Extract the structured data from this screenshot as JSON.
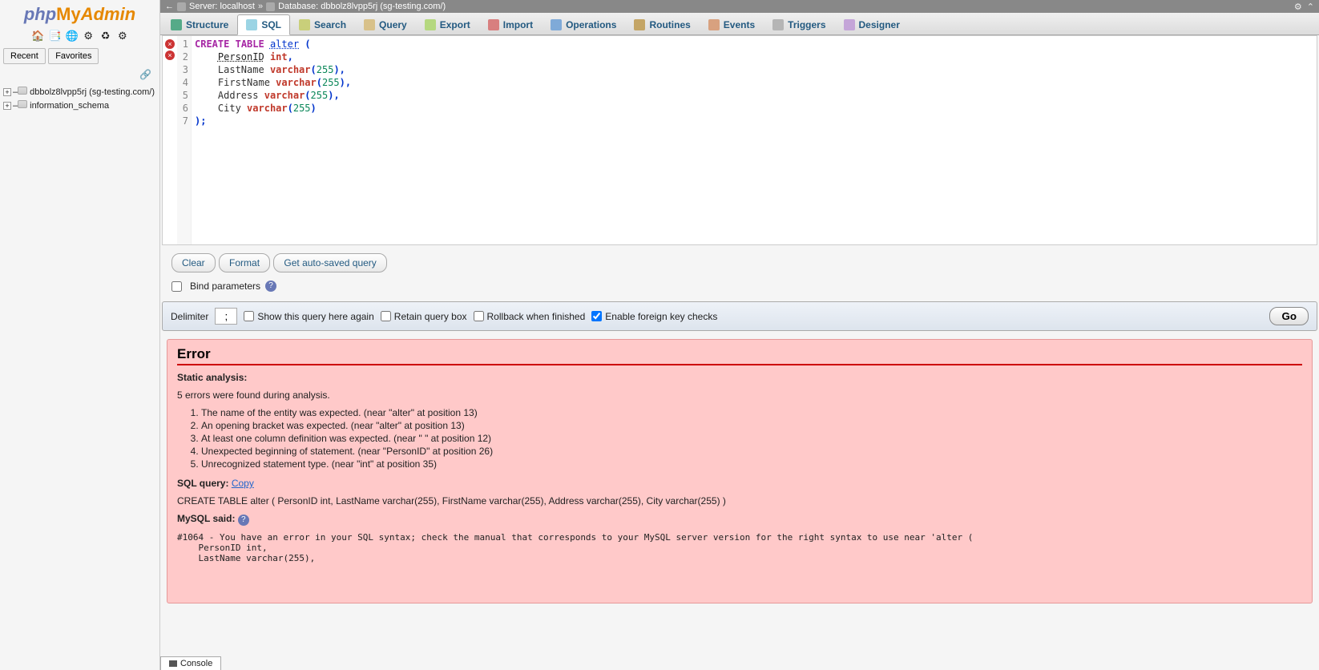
{
  "logo": {
    "php": "php",
    "my": "My",
    "admin": "Admin"
  },
  "sidebar_icons": [
    "🏠",
    "📑",
    "🌐",
    "⚙",
    "♻",
    "⚙"
  ],
  "recent_favorites": {
    "recent": "Recent",
    "favorites": "Favorites"
  },
  "db_tree": [
    {
      "name": "dbbolz8lvpp5rj (sg-testing.com/)"
    },
    {
      "name": "information_schema"
    }
  ],
  "topbar": {
    "back": "←",
    "server_label": "Server: localhost",
    "db_label": "Database: dbbolz8lvpp5rj (sg-testing.com/)",
    "sep": "»"
  },
  "tabs": [
    {
      "label": "Structure",
      "icon": "ic-structure"
    },
    {
      "label": "SQL",
      "icon": "ic-sql",
      "active": true
    },
    {
      "label": "Search",
      "icon": "ic-search"
    },
    {
      "label": "Query",
      "icon": "ic-query"
    },
    {
      "label": "Export",
      "icon": "ic-export"
    },
    {
      "label": "Import",
      "icon": "ic-import"
    },
    {
      "label": "Operations",
      "icon": "ic-ops"
    },
    {
      "label": "Routines",
      "icon": "ic-rout"
    },
    {
      "label": "Events",
      "icon": "ic-events"
    },
    {
      "label": "Triggers",
      "icon": "ic-trig"
    },
    {
      "label": "Designer",
      "icon": "ic-des"
    }
  ],
  "sql_lines": [
    {
      "n": "1",
      "err": true,
      "html": "<span class='kw-create'>CREATE</span> <span class='kw-table'>TABLE</span> <span class='kw-alter'>alter</span> <span class='kw-punct'>(</span>"
    },
    {
      "n": "2",
      "err": true,
      "html": "    <span class='kw-personid'>PersonID</span> <span class='kw-type'>int</span><span class='kw-punct'>,</span>"
    },
    {
      "n": "3",
      "html": "    <span class='kw-col'>LastName</span> <span class='kw-type'>varchar</span><span class='kw-punct'>(</span><span class='kw-num'>255</span><span class='kw-punct'>),</span>"
    },
    {
      "n": "4",
      "html": "    <span class='kw-col'>FirstName</span> <span class='kw-type'>varchar</span><span class='kw-punct'>(</span><span class='kw-num'>255</span><span class='kw-punct'>),</span>"
    },
    {
      "n": "5",
      "html": "    <span class='kw-col'>Address</span> <span class='kw-type'>varchar</span><span class='kw-punct'>(</span><span class='kw-num'>255</span><span class='kw-punct'>),</span>"
    },
    {
      "n": "6",
      "html": "    <span class='kw-col'>City</span> <span class='kw-type'>varchar</span><span class='kw-punct'>(</span><span class='kw-num'>255</span><span class='kw-punct'>)</span>"
    },
    {
      "n": "7",
      "html": "<span class='kw-punct'>);</span>"
    }
  ],
  "buttons": {
    "clear": "Clear",
    "format": "Format",
    "autosaved": "Get auto-saved query"
  },
  "bind_parameters": "Bind parameters",
  "query_bar": {
    "delimiter_label": "Delimiter",
    "delimiter_value": ";",
    "show_again": "Show this query here again",
    "retain": "Retain query box",
    "rollback": "Rollback when finished",
    "foreign": "Enable foreign key checks",
    "go": "Go"
  },
  "error": {
    "title": "Error",
    "static_analysis": "Static analysis:",
    "found": "5 errors were found during analysis.",
    "items": [
      "The name of the entity was expected. (near \"alter\" at position 13)",
      "An opening bracket was expected. (near \"alter\" at position 13)",
      "At least one column definition was expected. (near \" \" at position 12)",
      "Unexpected beginning of statement. (near \"PersonID\" at position 26)",
      "Unrecognized statement type. (near \"int\" at position 35)"
    ],
    "sql_query_label": "SQL query:",
    "copy": "Copy",
    "sql_query_text": "CREATE TABLE alter ( PersonID int, LastName varchar(255), FirstName varchar(255), Address varchar(255), City varchar(255) )",
    "mysql_said": "MySQL said:",
    "mysql_msg": "#1064 - You have an error in your SQL syntax; check the manual that corresponds to your MySQL server version for the right syntax to use near 'alter (\n    PersonID int,\n    LastName varchar(255),"
  },
  "console": "Console"
}
